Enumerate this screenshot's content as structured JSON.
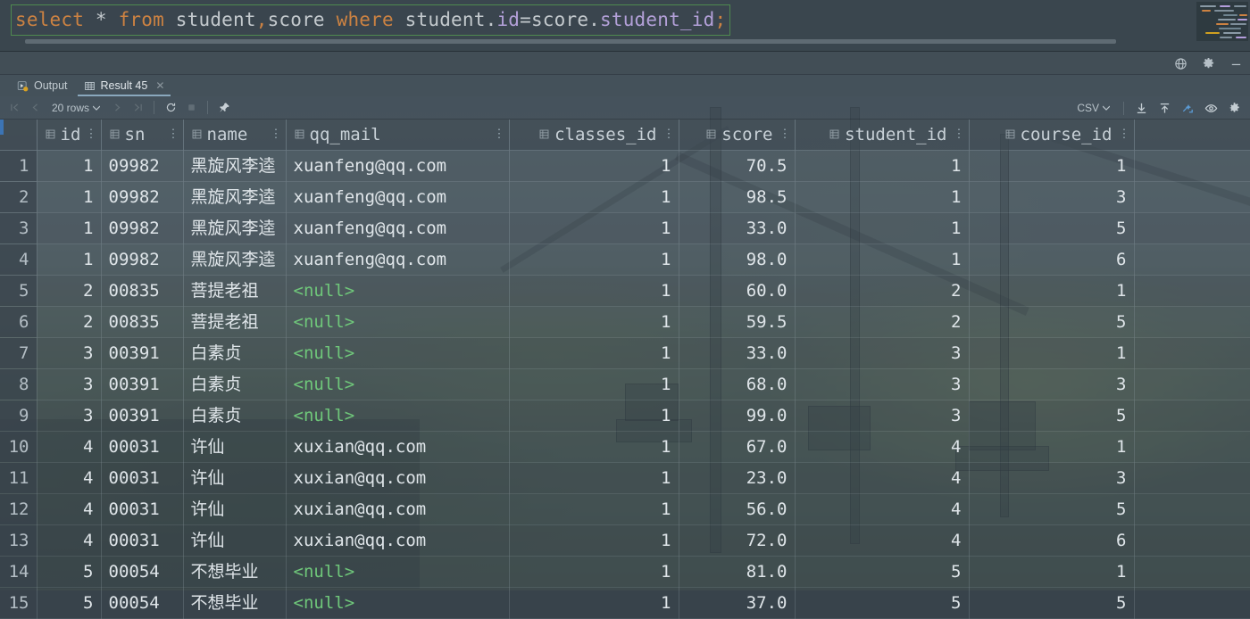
{
  "editor": {
    "sql_tokens": [
      {
        "t": "select",
        "k": "kw"
      },
      {
        "t": " ",
        "k": "plain"
      },
      {
        "t": "*",
        "k": "plain"
      },
      {
        "t": " ",
        "k": "plain"
      },
      {
        "t": "from",
        "k": "kw"
      },
      {
        "t": " student",
        "k": "plain"
      },
      {
        "t": ",",
        "k": "kw"
      },
      {
        "t": "score",
        "k": "plain"
      },
      {
        "t": " ",
        "k": "plain"
      },
      {
        "t": "where",
        "k": "kw"
      },
      {
        "t": " student.",
        "k": "plain"
      },
      {
        "t": "id",
        "k": "col"
      },
      {
        "t": "=score.",
        "k": "plain"
      },
      {
        "t": "student_id",
        "k": "col"
      },
      {
        "t": ";",
        "k": "semi"
      }
    ],
    "sql_text": "select * from student,score where student.id=score.student_id;"
  },
  "panel_header": {
    "icons": [
      "globe-icon",
      "settings-icon",
      "minimize-icon"
    ]
  },
  "tabs": [
    {
      "label": "Output",
      "icon": "output-icon",
      "active": false,
      "closable": false
    },
    {
      "label": "Result 45",
      "icon": "table-grid-icon",
      "active": true,
      "closable": true
    }
  ],
  "toolbar": {
    "first_page": "first-page-icon",
    "prev_page": "prev-page-icon",
    "rows_label": "20 rows",
    "next_page": "next-page-icon",
    "last_page": "last-page-icon",
    "refresh": "refresh-icon",
    "stop": "stop-icon",
    "pin": "pin-icon",
    "format_label": "CSV",
    "download": "download-icon",
    "upload": "upload-icon",
    "transpose": "transpose-icon",
    "view": "eye-icon",
    "settings": "gear-icon"
  },
  "grid": {
    "columns": [
      {
        "name": "id",
        "align": "right"
      },
      {
        "name": "sn",
        "align": "left"
      },
      {
        "name": "name",
        "align": "left"
      },
      {
        "name": "qq_mail",
        "align": "left"
      },
      {
        "name": "classes_id",
        "align": "right"
      },
      {
        "name": "score",
        "align": "right"
      },
      {
        "name": "student_id",
        "align": "right"
      },
      {
        "name": "course_id",
        "align": "right"
      }
    ],
    "rows": [
      {
        "n": "1",
        "id": "1",
        "sn": "09982",
        "name": "黑旋风李逵",
        "qq_mail": "xuanfeng@qq.com",
        "classes_id": "1",
        "score": "70.5",
        "student_id": "1",
        "course_id": "1"
      },
      {
        "n": "2",
        "id": "1",
        "sn": "09982",
        "name": "黑旋风李逵",
        "qq_mail": "xuanfeng@qq.com",
        "classes_id": "1",
        "score": "98.5",
        "student_id": "1",
        "course_id": "3"
      },
      {
        "n": "3",
        "id": "1",
        "sn": "09982",
        "name": "黑旋风李逵",
        "qq_mail": "xuanfeng@qq.com",
        "classes_id": "1",
        "score": "33.0",
        "student_id": "1",
        "course_id": "5"
      },
      {
        "n": "4",
        "id": "1",
        "sn": "09982",
        "name": "黑旋风李逵",
        "qq_mail": "xuanfeng@qq.com",
        "classes_id": "1",
        "score": "98.0",
        "student_id": "1",
        "course_id": "6"
      },
      {
        "n": "5",
        "id": "2",
        "sn": "00835",
        "name": "菩提老祖",
        "qq_mail": "<null>",
        "classes_id": "1",
        "score": "60.0",
        "student_id": "2",
        "course_id": "1"
      },
      {
        "n": "6",
        "id": "2",
        "sn": "00835",
        "name": "菩提老祖",
        "qq_mail": "<null>",
        "classes_id": "1",
        "score": "59.5",
        "student_id": "2",
        "course_id": "5"
      },
      {
        "n": "7",
        "id": "3",
        "sn": "00391",
        "name": "白素贞",
        "qq_mail": "<null>",
        "classes_id": "1",
        "score": "33.0",
        "student_id": "3",
        "course_id": "1"
      },
      {
        "n": "8",
        "id": "3",
        "sn": "00391",
        "name": "白素贞",
        "qq_mail": "<null>",
        "classes_id": "1",
        "score": "68.0",
        "student_id": "3",
        "course_id": "3"
      },
      {
        "n": "9",
        "id": "3",
        "sn": "00391",
        "name": "白素贞",
        "qq_mail": "<null>",
        "classes_id": "1",
        "score": "99.0",
        "student_id": "3",
        "course_id": "5"
      },
      {
        "n": "10",
        "id": "4",
        "sn": "00031",
        "name": "许仙",
        "qq_mail": "xuxian@qq.com",
        "classes_id": "1",
        "score": "67.0",
        "student_id": "4",
        "course_id": "1"
      },
      {
        "n": "11",
        "id": "4",
        "sn": "00031",
        "name": "许仙",
        "qq_mail": "xuxian@qq.com",
        "classes_id": "1",
        "score": "23.0",
        "student_id": "4",
        "course_id": "3"
      },
      {
        "n": "12",
        "id": "4",
        "sn": "00031",
        "name": "许仙",
        "qq_mail": "xuxian@qq.com",
        "classes_id": "1",
        "score": "56.0",
        "student_id": "4",
        "course_id": "5"
      },
      {
        "n": "13",
        "id": "4",
        "sn": "00031",
        "name": "许仙",
        "qq_mail": "xuxian@qq.com",
        "classes_id": "1",
        "score": "72.0",
        "student_id": "4",
        "course_id": "6"
      },
      {
        "n": "14",
        "id": "5",
        "sn": "00054",
        "name": "不想毕业",
        "qq_mail": "<null>",
        "classes_id": "1",
        "score": "81.0",
        "student_id": "5",
        "course_id": "1"
      },
      {
        "n": "15",
        "id": "5",
        "sn": "00054",
        "name": "不想毕业",
        "qq_mail": "<null>",
        "classes_id": "1",
        "score": "37.0",
        "student_id": "5",
        "course_id": "5"
      }
    ],
    "null_token": "<null>"
  },
  "colors": {
    "keyword": "#cc8242",
    "column_ref": "#b3a0d8",
    "null_green": "#6fc77a",
    "accent_blue": "#5b9bd5",
    "selection_border": "#4f8a4f"
  }
}
